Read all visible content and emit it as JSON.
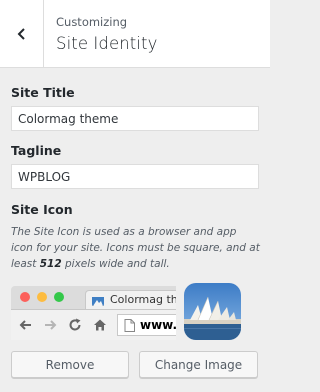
{
  "header": {
    "subtitle": "Customizing",
    "title": "Site Identity",
    "back_icon": "chevron-left-icon"
  },
  "site_title": {
    "label": "Site Title",
    "value": "Colormag theme"
  },
  "tagline": {
    "label": "Tagline",
    "value": "WPBLOG"
  },
  "site_icon": {
    "label": "Site Icon",
    "description_before": "The Site Icon is used as a browser and app icon for your site. Icons must be square, and at least ",
    "description_bold": "512",
    "description_after": " pixels wide and tall.",
    "preview": {
      "tab_title": "Colormag th",
      "url": "www."
    },
    "remove_label": "Remove",
    "change_label": "Change Image"
  },
  "colors": {
    "panel_bg": "#eeeeee",
    "header_bg": "#ffffff",
    "heading": "#23282d",
    "text": "#555d66"
  }
}
